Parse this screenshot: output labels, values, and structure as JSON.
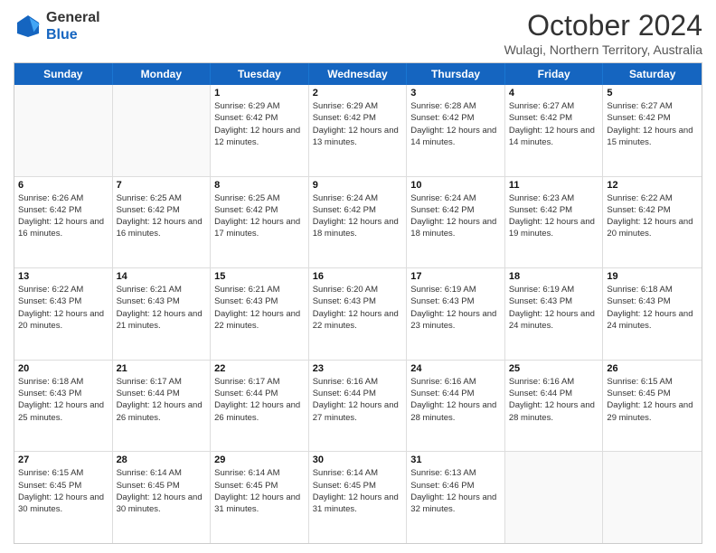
{
  "logo": {
    "line1": "General",
    "line2": "Blue"
  },
  "title": "October 2024",
  "location": "Wulagi, Northern Territory, Australia",
  "days_of_week": [
    "Sunday",
    "Monday",
    "Tuesday",
    "Wednesday",
    "Thursday",
    "Friday",
    "Saturday"
  ],
  "weeks": [
    [
      {
        "day": "",
        "sunrise": "",
        "sunset": "",
        "daylight": ""
      },
      {
        "day": "",
        "sunrise": "",
        "sunset": "",
        "daylight": ""
      },
      {
        "day": "1",
        "sunrise": "Sunrise: 6:29 AM",
        "sunset": "Sunset: 6:42 PM",
        "daylight": "Daylight: 12 hours and 12 minutes."
      },
      {
        "day": "2",
        "sunrise": "Sunrise: 6:29 AM",
        "sunset": "Sunset: 6:42 PM",
        "daylight": "Daylight: 12 hours and 13 minutes."
      },
      {
        "day": "3",
        "sunrise": "Sunrise: 6:28 AM",
        "sunset": "Sunset: 6:42 PM",
        "daylight": "Daylight: 12 hours and 14 minutes."
      },
      {
        "day": "4",
        "sunrise": "Sunrise: 6:27 AM",
        "sunset": "Sunset: 6:42 PM",
        "daylight": "Daylight: 12 hours and 14 minutes."
      },
      {
        "day": "5",
        "sunrise": "Sunrise: 6:27 AM",
        "sunset": "Sunset: 6:42 PM",
        "daylight": "Daylight: 12 hours and 15 minutes."
      }
    ],
    [
      {
        "day": "6",
        "sunrise": "Sunrise: 6:26 AM",
        "sunset": "Sunset: 6:42 PM",
        "daylight": "Daylight: 12 hours and 16 minutes."
      },
      {
        "day": "7",
        "sunrise": "Sunrise: 6:25 AM",
        "sunset": "Sunset: 6:42 PM",
        "daylight": "Daylight: 12 hours and 16 minutes."
      },
      {
        "day": "8",
        "sunrise": "Sunrise: 6:25 AM",
        "sunset": "Sunset: 6:42 PM",
        "daylight": "Daylight: 12 hours and 17 minutes."
      },
      {
        "day": "9",
        "sunrise": "Sunrise: 6:24 AM",
        "sunset": "Sunset: 6:42 PM",
        "daylight": "Daylight: 12 hours and 18 minutes."
      },
      {
        "day": "10",
        "sunrise": "Sunrise: 6:24 AM",
        "sunset": "Sunset: 6:42 PM",
        "daylight": "Daylight: 12 hours and 18 minutes."
      },
      {
        "day": "11",
        "sunrise": "Sunrise: 6:23 AM",
        "sunset": "Sunset: 6:42 PM",
        "daylight": "Daylight: 12 hours and 19 minutes."
      },
      {
        "day": "12",
        "sunrise": "Sunrise: 6:22 AM",
        "sunset": "Sunset: 6:42 PM",
        "daylight": "Daylight: 12 hours and 20 minutes."
      }
    ],
    [
      {
        "day": "13",
        "sunrise": "Sunrise: 6:22 AM",
        "sunset": "Sunset: 6:43 PM",
        "daylight": "Daylight: 12 hours and 20 minutes."
      },
      {
        "day": "14",
        "sunrise": "Sunrise: 6:21 AM",
        "sunset": "Sunset: 6:43 PM",
        "daylight": "Daylight: 12 hours and 21 minutes."
      },
      {
        "day": "15",
        "sunrise": "Sunrise: 6:21 AM",
        "sunset": "Sunset: 6:43 PM",
        "daylight": "Daylight: 12 hours and 22 minutes."
      },
      {
        "day": "16",
        "sunrise": "Sunrise: 6:20 AM",
        "sunset": "Sunset: 6:43 PM",
        "daylight": "Daylight: 12 hours and 22 minutes."
      },
      {
        "day": "17",
        "sunrise": "Sunrise: 6:19 AM",
        "sunset": "Sunset: 6:43 PM",
        "daylight": "Daylight: 12 hours and 23 minutes."
      },
      {
        "day": "18",
        "sunrise": "Sunrise: 6:19 AM",
        "sunset": "Sunset: 6:43 PM",
        "daylight": "Daylight: 12 hours and 24 minutes."
      },
      {
        "day": "19",
        "sunrise": "Sunrise: 6:18 AM",
        "sunset": "Sunset: 6:43 PM",
        "daylight": "Daylight: 12 hours and 24 minutes."
      }
    ],
    [
      {
        "day": "20",
        "sunrise": "Sunrise: 6:18 AM",
        "sunset": "Sunset: 6:43 PM",
        "daylight": "Daylight: 12 hours and 25 minutes."
      },
      {
        "day": "21",
        "sunrise": "Sunrise: 6:17 AM",
        "sunset": "Sunset: 6:44 PM",
        "daylight": "Daylight: 12 hours and 26 minutes."
      },
      {
        "day": "22",
        "sunrise": "Sunrise: 6:17 AM",
        "sunset": "Sunset: 6:44 PM",
        "daylight": "Daylight: 12 hours and 26 minutes."
      },
      {
        "day": "23",
        "sunrise": "Sunrise: 6:16 AM",
        "sunset": "Sunset: 6:44 PM",
        "daylight": "Daylight: 12 hours and 27 minutes."
      },
      {
        "day": "24",
        "sunrise": "Sunrise: 6:16 AM",
        "sunset": "Sunset: 6:44 PM",
        "daylight": "Daylight: 12 hours and 28 minutes."
      },
      {
        "day": "25",
        "sunrise": "Sunrise: 6:16 AM",
        "sunset": "Sunset: 6:44 PM",
        "daylight": "Daylight: 12 hours and 28 minutes."
      },
      {
        "day": "26",
        "sunrise": "Sunrise: 6:15 AM",
        "sunset": "Sunset: 6:45 PM",
        "daylight": "Daylight: 12 hours and 29 minutes."
      }
    ],
    [
      {
        "day": "27",
        "sunrise": "Sunrise: 6:15 AM",
        "sunset": "Sunset: 6:45 PM",
        "daylight": "Daylight: 12 hours and 30 minutes."
      },
      {
        "day": "28",
        "sunrise": "Sunrise: 6:14 AM",
        "sunset": "Sunset: 6:45 PM",
        "daylight": "Daylight: 12 hours and 30 minutes."
      },
      {
        "day": "29",
        "sunrise": "Sunrise: 6:14 AM",
        "sunset": "Sunset: 6:45 PM",
        "daylight": "Daylight: 12 hours and 31 minutes."
      },
      {
        "day": "30",
        "sunrise": "Sunrise: 6:14 AM",
        "sunset": "Sunset: 6:45 PM",
        "daylight": "Daylight: 12 hours and 31 minutes."
      },
      {
        "day": "31",
        "sunrise": "Sunrise: 6:13 AM",
        "sunset": "Sunset: 6:46 PM",
        "daylight": "Daylight: 12 hours and 32 minutes."
      },
      {
        "day": "",
        "sunrise": "",
        "sunset": "",
        "daylight": ""
      },
      {
        "day": "",
        "sunrise": "",
        "sunset": "",
        "daylight": ""
      }
    ]
  ]
}
